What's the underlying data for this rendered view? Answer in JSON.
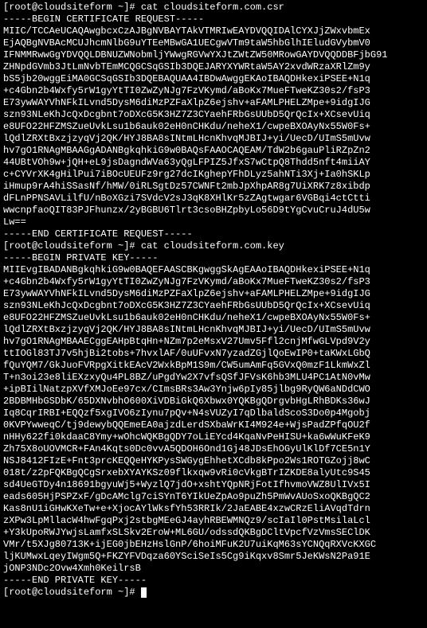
{
  "line01": "[root@cloudsiteform ~]# cat cloudsiteform.com.csr",
  "line02": "-----BEGIN CERTIFICATE REQUEST-----",
  "line03": "MIIC/TCCAeUCAQAwgbcxCzAJBgNVBAYTAkVTMRIwEAYDVQQIDAlCYXJjZWxvbmEx",
  "line04": "EjAQBgNVBAcMCUJhcmNlbG9uYTEeMBwGA1UECgwVTm9taW5hbGlhIEludGVybmV0",
  "line05": "IFNMMRwwGgYDVQQLDBNUZWNobmljYWwgRGVwYXJtZWtZW50MRowGAYDVQQDDBFjbG91",
  "line06": "ZHNpdGVmb3JtLmNvbTEmMCQGCSqGSIb3DQEJARYXYWRtaW5AY2xvdWRzaXRlZm9y",
  "line07": "bS5jb20wggEiMA0GCSqGSIb3DQEBAQUAA4IBDwAwggEKAoIBAQDHkexiPSEE+N1q",
  "line08": "+c4Gbn2b4Wxfy5rW1gyYtTI0ZwZyNJg7FzVKymd/aBoKx7MueFTweKZ30s2/fsP3",
  "line09": "E73ywWAYVhNFkILvnd5DysM6diMzPZFaXlpZ6ejshv+aFAMLPHELZMpe+9idgIJG",
  "line10": "szn93NLeKhJcQxDcgbnt7oDXcG5K3HZ7Z3CYaehFRbGsUUbD5QrQcIx+XCsevUiq",
  "line11": "e8UFO22HFZMSZueUvkLsu1b6auk02eH0nCHKdu/neheX1/cwpeBXOAyNx55W0Fs+",
  "line12": "lQdlZRXtBxzjzyqVj2QK/HYJ8BA8sINtmLHcnKhvqMJBIJ+yi/UecD/UImS5mUvw",
  "line13": "hv7gO1RNAgMBAAGgADANBgkqhkiG9w0BAQsFAAOCAQEAM/TdW2b6gauPliRZpZn2",
  "line14": "44UBtVOh9w+jQH+eL9jsDagndWVa63yQgLFPIZ5JfxS7wCtpQ8Thdd5nft4miiAY",
  "line15": "c+CYVrXK4gHilPui7iBOcUEUFz9rg27dcIKghepYFhDLyz5ahNTi3Xj+Ia0hSKLp",
  "line16": "iHmup9rA4hiSSasNf/hMW/0iRLSgtDz57CWNFt2mbJpXhpAR8g7UiXRK7z8xibdp",
  "line17": "dFLnPPNSAVLilfU/nBoXGzi7SVdcV2sJ3qK8XHlKr5zZAgtwgar6VGBqi4ctCtti",
  "line18": "wwcnpfaoQIT83PJFhunzx/2yBGBU6Tlrt3csoBHZpbyLo56D9tYgCvuCruJ4dU5w",
  "line19": "Lw==",
  "line20": "-----END CERTIFICATE REQUEST-----",
  "line21": "[root@cloudsiteform ~]# cat cloudsiteform.com.key",
  "line22": "-----BEGIN PRIVATE KEY-----",
  "line23": "MIIEvgIBADANBgkqhkiG9w0BAQEFAASCBKgwggSkAgEAAoIBAQDHkexiPSEE+N1q",
  "line24": "+c4Gbn2b4Wxfy5rW1gyYtTI0ZwZyNJg7FzVKymd/aBoKx7MueFTweKZ30s2/fsP3",
  "line25": "E73ywWAYVhNFkILvnd5DysM6diMzPZFaXlpZ6ejshv+aFAMLPHELZMpe+9idgIJG",
  "line26": "szn93NLeKhJcQxDcgbnt7oDXcG5K3HZ7Z3CYaehFRbGsUUbD5QrQcIx+XCsevUiq",
  "line27": "e8UFO22HFZMSZueUvkLsu1b6auk02eH0nCHKdu/neheX1/cwpeBXOAyNx55W0Fs+",
  "line28": "lQdlZRXtBxzjzyqVj2QK/HYJ8BA8sINtmLHcnKhvqMJBIJ+yi/UecD/UImS5mUvw",
  "line29": "hv7gO1RNAgMBAAECggEAHpBtqHn+NZm7p2eMsxV27Umv5Ffl2cnjMfwGLVpd9V2y",
  "line30": "ttIOGl83TJ7v5hjBi2tobs+7hvxlAF/0uUFvxN7yzadZGjlQoEwIP0+taKWxLGbQ",
  "line31": "fQuYQM7/GkJuoFVRpgXitkEAcV2WxkBpM1S9m/CW5umAmFq5GVxQ0mzF1LkmWxZl",
  "line32": "T+n3oi23e8liEXzxyQu4PL8BZ/uPgdYw2X7vfsQSfJFVsK6hb3MLU4PC1AtN0vMw",
  "line33": "+ipBIilNatzpXVfXMJoEe97cx/CImsBRs3Aw3Ynjw6pIy85jlbg9RyQW6aNDdCWO",
  "line34": "2BDBMHbGSDbK/65DXNvbhO600XiVDBiGkQ6Xbwx0YQKBgQDrgvbHgLRhBDKs36wJ",
  "line35": "Iq8CqrIRBI+EQQzf5xgIVO6zIynu7pQv+N4sVUZyI7qDlbaldScoS3Do0p4Mgobj",
  "line36": "0KVPYwweqC/tj9dewybQQEmeEA0ajzdLerdSXbaWrKI4M924e+WjsPadZPfqOU2f",
  "line37": "nHHy622fi0kdaaC8Ymy+wOhcWQKBgQDY7oLiEYcd4KqaNvPeHISU+ka6wWuKFeK9",
  "line38": "Zh75X8oUOVMCR+FAn4Kqts0Dc0vvA5QDOH6Ond1Gj48JDsEhOGyUlKlDf7CE5n1Y",
  "line39": "NSJ8412FIzE+Fnt3prcKEQQeHYKPysSWGygEhhetXCdb8kPpo2Ws1ROTGZojj8wC",
  "line40": "018t/z2pFQKBgQCgSrxebXYAYKSz09flkxqw9vRi0cVkgBTrIZKDE8alyUtc9S45",
  "line41": "sd4UeGTDy4n18691bgyuWj5+WyzlQ7jdO+xshtYQpNRjFotIfhvmoVWZ8UlIVx5I",
  "line42": "eads605HjPSPZxF/gDcAMclg7ciSYnT6YIkUeZpAo9puZh5PmWvAUoSxoQKBgQC2",
  "line43": "Kas8nU1iGHwKXeTw+e+XjocAYlWksfYh53RRIk/2JaEABE4xzwCRzEliAVqdTdrn",
  "line44": "zXPw3LpMllacW4hwFgqPxj2stbgMEeGJ4ayhRBEWMNQz9/scIaIl0PstMsilaLcl",
  "line45": "+Y3kUpoRWJYwjsLamfxSLSkv2EroW+ML6GU/odssdQKBgDCltVpcfVzVmsSEClDK",
  "line46": "VMr/t5XJg80713K+ijEG0jbEHzHslGnP/6hoiMFuK2U7uiKqM63sYCNQqRXVcKXGC",
  "line47": "ljKUMwxLqeyIWgm5Q+FKZYFVDqza60YSciSeIs5Cg9iKqxv8Smr5JeKWsN2Pa91E",
  "line48": "jONP3NDc2Ovw4Xmh0KeilrsB",
  "line49": "-----END PRIVATE KEY-----",
  "line50": "[root@cloudsiteform ~]# "
}
